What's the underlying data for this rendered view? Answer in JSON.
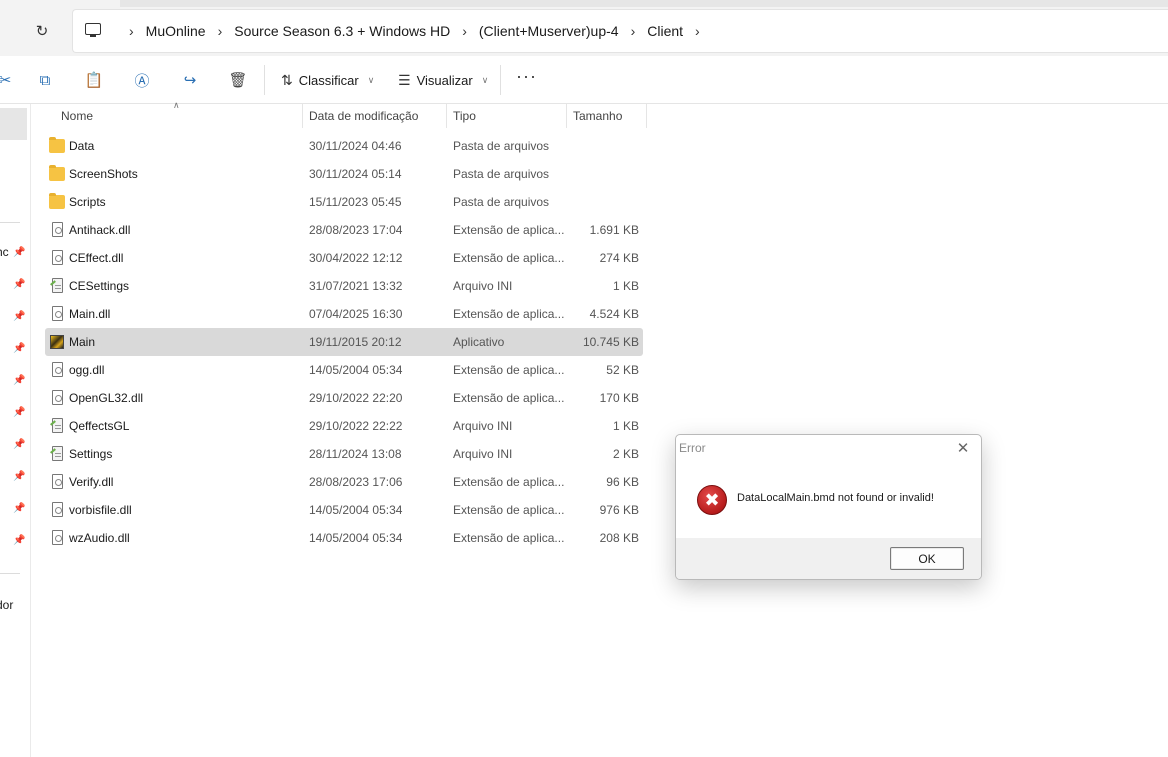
{
  "breadcrumb": {
    "items": [
      "MuOnline",
      "Source Season 6.3 + Windows HD",
      "(Client+Muserver)up-4",
      "Client"
    ]
  },
  "toolbar": {
    "sort_label": "Classificar",
    "view_label": "Visualizar",
    "more_label": "···"
  },
  "nav": {
    "partial_label_1": "hc",
    "partial_label_2": "dor"
  },
  "columns": {
    "name": "Nome",
    "date": "Data de modificação",
    "type": "Tipo",
    "size": "Tamanho"
  },
  "files": [
    {
      "name": "Data",
      "date": "30/11/2024 04:46",
      "type": "Pasta de arquivos",
      "size": "",
      "icon": "folder-icon"
    },
    {
      "name": "ScreenShots",
      "date": "30/11/2024 05:14",
      "type": "Pasta de arquivos",
      "size": "",
      "icon": "folder-icon"
    },
    {
      "name": "Scripts",
      "date": "15/11/2023 05:45",
      "type": "Pasta de arquivos",
      "size": "",
      "icon": "folder-icon"
    },
    {
      "name": "Antihack.dll",
      "date": "28/08/2023 17:04",
      "type": "Extensão de aplica...",
      "size": "1.691 KB",
      "icon": "dll-icon"
    },
    {
      "name": "CEffect.dll",
      "date": "30/04/2022 12:12",
      "type": "Extensão de aplica...",
      "size": "274 KB",
      "icon": "dll-icon"
    },
    {
      "name": "CESettings",
      "date": "31/07/2021 13:32",
      "type": "Arquivo INI",
      "size": "1 KB",
      "icon": "ini-icon"
    },
    {
      "name": "Main.dll",
      "date": "07/04/2025 16:30",
      "type": "Extensão de aplica...",
      "size": "4.524 KB",
      "icon": "dll-icon"
    },
    {
      "name": "Main",
      "date": "19/11/2015 20:12",
      "type": "Aplicativo",
      "size": "10.745 KB",
      "icon": "app-icon",
      "selected": true
    },
    {
      "name": "ogg.dll",
      "date": "14/05/2004 05:34",
      "type": "Extensão de aplica...",
      "size": "52 KB",
      "icon": "dll-icon"
    },
    {
      "name": "OpenGL32.dll",
      "date": "29/10/2022 22:20",
      "type": "Extensão de aplica...",
      "size": "170 KB",
      "icon": "dll-icon"
    },
    {
      "name": "QeffectsGL",
      "date": "29/10/2022 22:22",
      "type": "Arquivo INI",
      "size": "1 KB",
      "icon": "ini-icon"
    },
    {
      "name": "Settings",
      "date": "28/11/2024 13:08",
      "type": "Arquivo INI",
      "size": "2 KB",
      "icon": "ini-icon"
    },
    {
      "name": "Verify.dll",
      "date": "28/08/2023 17:06",
      "type": "Extensão de aplica...",
      "size": "96 KB",
      "icon": "dll-icon"
    },
    {
      "name": "vorbisfile.dll",
      "date": "14/05/2004 05:34",
      "type": "Extensão de aplica...",
      "size": "976 KB",
      "icon": "dll-icon"
    },
    {
      "name": "wzAudio.dll",
      "date": "14/05/2004 05:34",
      "type": "Extensão de aplica...",
      "size": "208 KB",
      "icon": "dll-icon"
    }
  ],
  "dialog": {
    "title": "Error",
    "message": "DataLocalMain.bmd not found or invalid!",
    "ok_label": "OK",
    "icon": "error-icon"
  }
}
